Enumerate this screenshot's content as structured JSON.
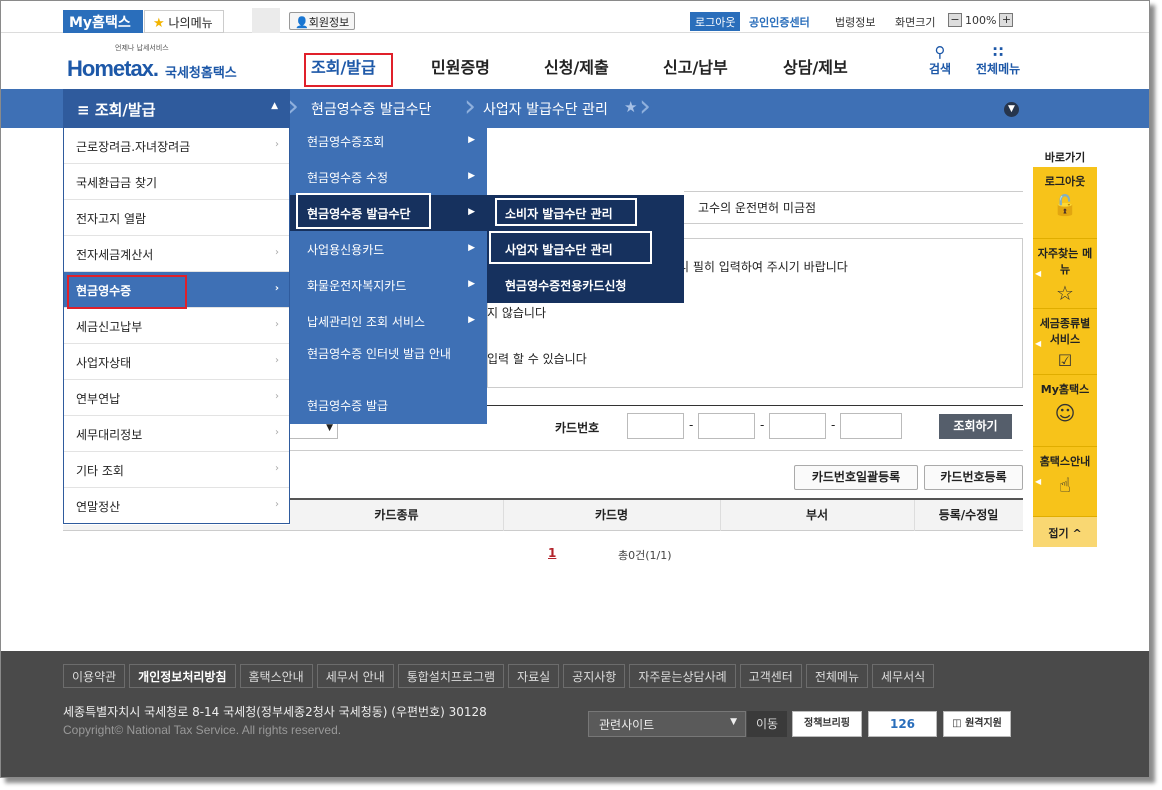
{
  "topbar": {
    "my_hometax": "My홈택스",
    "my_menu": "나의메뉴",
    "member_info": "회원정보",
    "logout": "로그아웃",
    "cert_center": "공인인증센터",
    "law_info": "법령정보",
    "screen_size": "화면크기",
    "zoom_minus": "−",
    "zoom_level": "100%",
    "zoom_plus": "+"
  },
  "header": {
    "logo_small": "언제나 납세서비스",
    "logo_main": "Hometax.",
    "logo_sub": "국세청홈택스",
    "nav": [
      "조회/발급",
      "민원증명",
      "신청/제출",
      "신고/납부",
      "상담/제보"
    ],
    "search": "검색",
    "all_menu": "전체메뉴"
  },
  "breadcrumb": {
    "menu_title": "조회/발급",
    "items": [
      "현금영수증 발급수단",
      "사업자 발급수단 관리"
    ]
  },
  "left_menu": [
    "근로장려금.자녀장려금",
    "국세환급금 찾기",
    "전자고지 열람",
    "전자세금계산서",
    "현금영수증",
    "세금신고납부",
    "사업자상태",
    "연부연납",
    "세무대리정보",
    "기타 조회",
    "연말정산"
  ],
  "mid_menu": [
    "현금영수증조회",
    "현금영수증 수정",
    "현금영수증 발급수단",
    "사업용신용카드",
    "화물운전자복지카드",
    "납세관리인 조회 서비스",
    "현금영수증 인터넷 발급 안내",
    "현금영수증 발급"
  ],
  "right_menu": [
    "소비자 발급수단 관리",
    "사업자 발급수단 관리",
    "현금영수증전용카드신청"
  ],
  "content": {
    "tab": "고수의 운전면허 미금점",
    "info_lines": [
      "니 필히 입력하여 주시기 바랍니다",
      "지 않습니다",
      "입력 할 수 있습니다"
    ],
    "card_label": "카드번호",
    "card_sep": "-",
    "search_btn": "조회하기",
    "bulk_register": "카드번호일괄등록",
    "register": "카드번호등록",
    "columns": [
      "카드종류",
      "카드명",
      "부서",
      "등록/수정일"
    ],
    "page": "1",
    "total": "총0건(1/1)"
  },
  "quick": {
    "title": "바로가기",
    "items": [
      "로그아웃",
      "자주찾는 메뉴",
      "세금종류별 서비스",
      "My홈택스",
      "홈택스안내"
    ],
    "fold": "접기"
  },
  "footer": {
    "links": [
      "이용약관",
      "개인정보처리방침",
      "홈택스안내",
      "세무서 안내",
      "통합설치프로그램",
      "자료실",
      "공지사항",
      "자주묻는상담사례",
      "고객센터",
      "전체메뉴",
      "세무서식"
    ],
    "address": "세종특별자치시 국세청로 8-14 국세청(정부세종2청사 국세청동) (우편번호) 30128",
    "copyright": "Copyright© National Tax Service. All rights reserved.",
    "related_site": "관련사이트",
    "move": "이동",
    "banner1": "정책브리핑",
    "banner2": "126",
    "banner3": "원격지원"
  }
}
